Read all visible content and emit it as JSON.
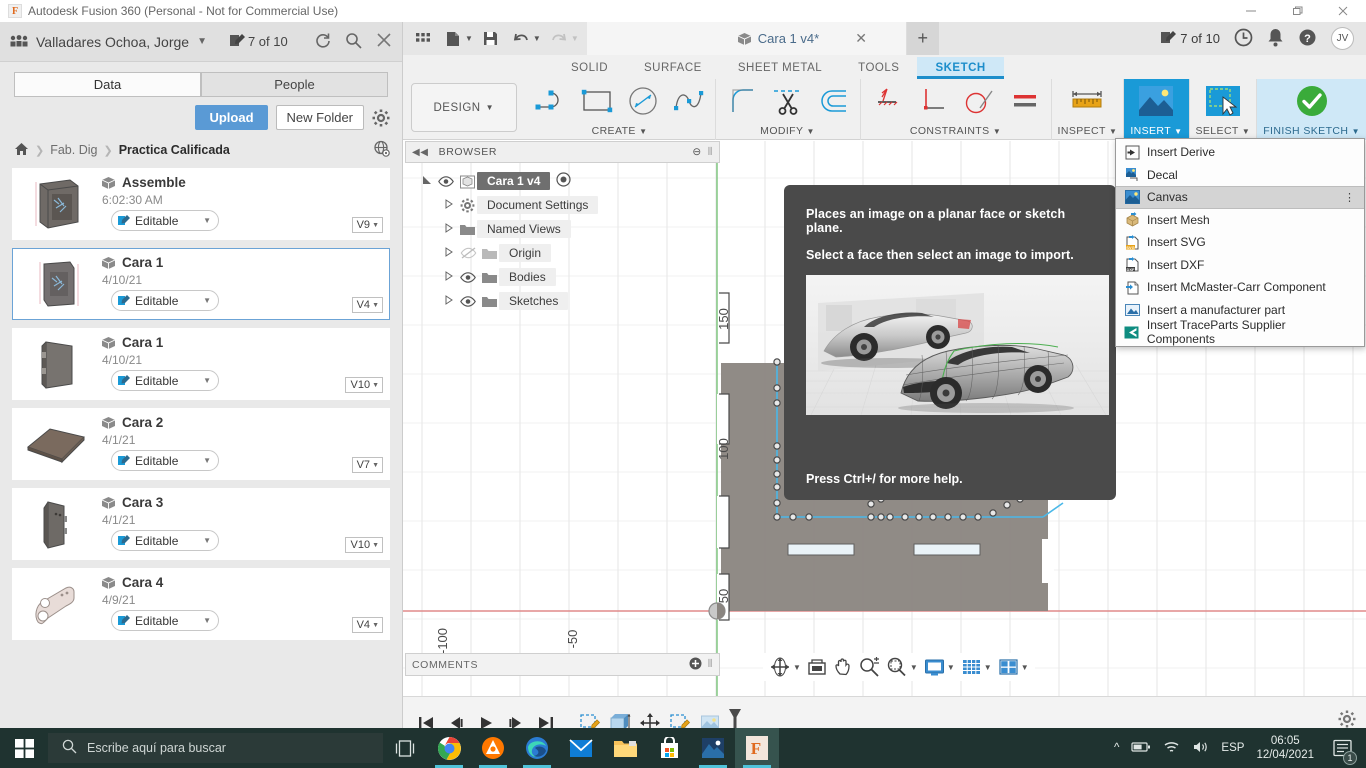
{
  "window": {
    "title": "Autodesk Fusion 360 (Personal - Not for Commercial Use)",
    "app_icon_letter": "F",
    "minimize": "—",
    "maximize": "❐",
    "close": "✕"
  },
  "data_panel": {
    "user_name": "Valladares Ochoa, Jorge",
    "user_caret": "▼",
    "edits_label": "7 of 10",
    "refresh_icon": "refresh-icon",
    "search_icon": "search-icon",
    "close_icon": "close-icon",
    "tabs": [
      {
        "label": "Data",
        "active": true
      },
      {
        "label": "People",
        "active": false
      }
    ],
    "upload_label": "Upload",
    "new_folder_label": "New Folder",
    "settings_icon": "gear-icon",
    "breadcrumb": {
      "home_icon": "home-icon",
      "items": [
        "Fab. Dig",
        "Practica Calificada"
      ],
      "separator": "❯",
      "globe_icon": "globe-icon"
    },
    "items": [
      {
        "name": "Assemble",
        "date": "6:02:30 AM",
        "status": "Editable",
        "version": "V9",
        "selected": false
      },
      {
        "name": "Cara 1",
        "date": "4/10/21",
        "status": "Editable",
        "version": "V4",
        "selected": true
      },
      {
        "name": "Cara 1",
        "date": "4/10/21",
        "status": "Editable",
        "version": "V10",
        "selected": false
      },
      {
        "name": "Cara 2",
        "date": "4/1/21",
        "status": "Editable",
        "version": "V7",
        "selected": false
      },
      {
        "name": "Cara 3",
        "date": "4/1/21",
        "status": "Editable",
        "version": "V10",
        "selected": false
      },
      {
        "name": "Cara 4",
        "date": "4/9/21",
        "status": "Editable",
        "version": "V4",
        "selected": false
      }
    ]
  },
  "fusion": {
    "quick_access": [
      "grid-icon",
      "new-file-icon",
      "save-icon",
      "undo-icon",
      "redo-icon"
    ],
    "document_tab": {
      "title": "Cara 1 v4*",
      "close": "✕"
    },
    "new_tab_label": "+",
    "edits_label": "7 of 10",
    "clock_icon": "recent-icon",
    "bell_icon": "notifications-icon",
    "help_icon": "help-icon",
    "avatar_initials": "JV",
    "workspace_label": "DESIGN",
    "workspace_caret": "▼",
    "tabs": [
      {
        "label": "SOLID",
        "active": false
      },
      {
        "label": "SURFACE",
        "active": false
      },
      {
        "label": "SHEET METAL",
        "active": false
      },
      {
        "label": "TOOLS",
        "active": false
      },
      {
        "label": "SKETCH",
        "active": true
      }
    ],
    "ribbon_groups": [
      {
        "label": "CREATE",
        "caret": "▼",
        "icons": [
          "line-icon",
          "rectangle-icon",
          "circle-icon",
          "spline-icon"
        ]
      },
      {
        "label": "MODIFY",
        "caret": "▼",
        "icons": [
          "fillet-icon",
          "trim-icon",
          "offset-icon"
        ]
      },
      {
        "label": "CONSTRAINTS",
        "caret": "▼",
        "icons": [
          "horizontal-vertical-icon",
          "perpendicular-icon",
          "tangent-icon",
          "equal-icon"
        ]
      },
      {
        "label": "INSPECT",
        "caret": "▼",
        "icons": [
          "measure-icon"
        ]
      },
      {
        "label": "INSERT",
        "caret": "▼",
        "icons": [
          "insert-image-icon"
        ],
        "highlight": true
      },
      {
        "label": "SELECT",
        "caret": "▼",
        "icons": [
          "select-cursor-icon"
        ]
      },
      {
        "label": "FINISH SKETCH",
        "caret": "▼",
        "icons": [
          "finish-check-icon"
        ],
        "finish": true
      }
    ],
    "browser": {
      "title": "BROWSER",
      "collapse_icon": "◀◀",
      "minus_icon": "⊖",
      "root": {
        "label": "Cara 1 v4",
        "eye": "visible"
      },
      "nodes": [
        {
          "label": "Document Settings",
          "icon": "gear-icon",
          "eye": false
        },
        {
          "label": "Named Views",
          "icon": "folder-icon",
          "eye": false
        },
        {
          "label": "Origin",
          "icon": "folder-icon",
          "eye": true,
          "hidden": true
        },
        {
          "label": "Bodies",
          "icon": "folder-icon",
          "eye": true
        },
        {
          "label": "Sketches",
          "icon": "folder-icon",
          "eye": true
        }
      ]
    },
    "comments": {
      "label": "COMMENTS",
      "add_icon": "plus-circle-icon"
    },
    "nav_toolbar": [
      "orbit-icon",
      "look-at-icon",
      "pan-icon",
      "zoom-icon",
      "zoom-window-icon",
      "display-settings-icon",
      "grid-snap-icon",
      "viewports-icon"
    ],
    "timeline": {
      "controls": [
        "go-to-start-icon",
        "step-back-icon",
        "play-icon",
        "step-forward-icon",
        "go-to-end-icon"
      ],
      "features": [
        "sketch-feature-icon",
        "extrude-feature-icon",
        "move-feature-icon",
        "sketch-feature-icon",
        "canvas-feature-icon"
      ],
      "settings_icon": "gear-icon"
    },
    "canvas": {
      "ruler_labels_vertical": [
        "150",
        "100",
        "50"
      ],
      "ruler_labels_horizontal": [
        "-100",
        "-50"
      ]
    }
  },
  "insert_menu": {
    "items": [
      {
        "label": "Insert Derive",
        "icon": "insert-derive-icon",
        "highlight": false
      },
      {
        "label": "Decal",
        "icon": "decal-icon",
        "highlight": false
      },
      {
        "label": "Canvas",
        "icon": "canvas-icon",
        "highlight": true,
        "overflow": "⋮"
      },
      {
        "label": "Insert Mesh",
        "icon": "insert-mesh-icon",
        "highlight": false
      },
      {
        "label": "Insert SVG",
        "icon": "insert-svg-icon",
        "highlight": false
      },
      {
        "label": "Insert DXF",
        "icon": "insert-dxf-icon",
        "highlight": false
      },
      {
        "label": "Insert McMaster-Carr Component",
        "icon": "mcmaster-icon",
        "highlight": false
      },
      {
        "label": "Insert a manufacturer part",
        "icon": "manufacturer-part-icon",
        "highlight": false
      },
      {
        "label": "Insert TraceParts Supplier Components",
        "icon": "traceparts-icon",
        "highlight": false
      }
    ]
  },
  "tooltip": {
    "line1": "Places an image on a planar face or sketch plane.",
    "line2": "Select a face then select an image to import.",
    "footer": "Press Ctrl+/ for more help.",
    "image_alt": "car-canvas-example-image"
  },
  "taskbar": {
    "start_icon": "windows-start-icon",
    "search_placeholder": "Escribe aquí para buscar",
    "search_icon": "search-icon",
    "task_view_icon": "task-view-icon",
    "pinned": [
      "chrome-icon",
      "avast-icon",
      "edge-icon",
      "mail-icon",
      "file-explorer-icon",
      "store-icon",
      "photos-icon",
      "fusion360-icon"
    ],
    "tray": {
      "chevron": "^",
      "battery_icon": "battery-icon",
      "wifi_icon": "wifi-icon",
      "volume_icon": "volume-icon",
      "language": "ESP"
    },
    "clock_time": "06:05",
    "clock_date": "12/04/2021",
    "notification_icon": "action-center-icon",
    "notification_count": "1"
  },
  "colors": {
    "accent_blue": "#1a9ad7",
    "upload_blue": "#5a9ad5",
    "finish_green": "#3aab3a",
    "taskbar": "#1f3330",
    "tooltip_bg": "#4a4a4a",
    "sketch_blue": "#4ab8e8"
  }
}
